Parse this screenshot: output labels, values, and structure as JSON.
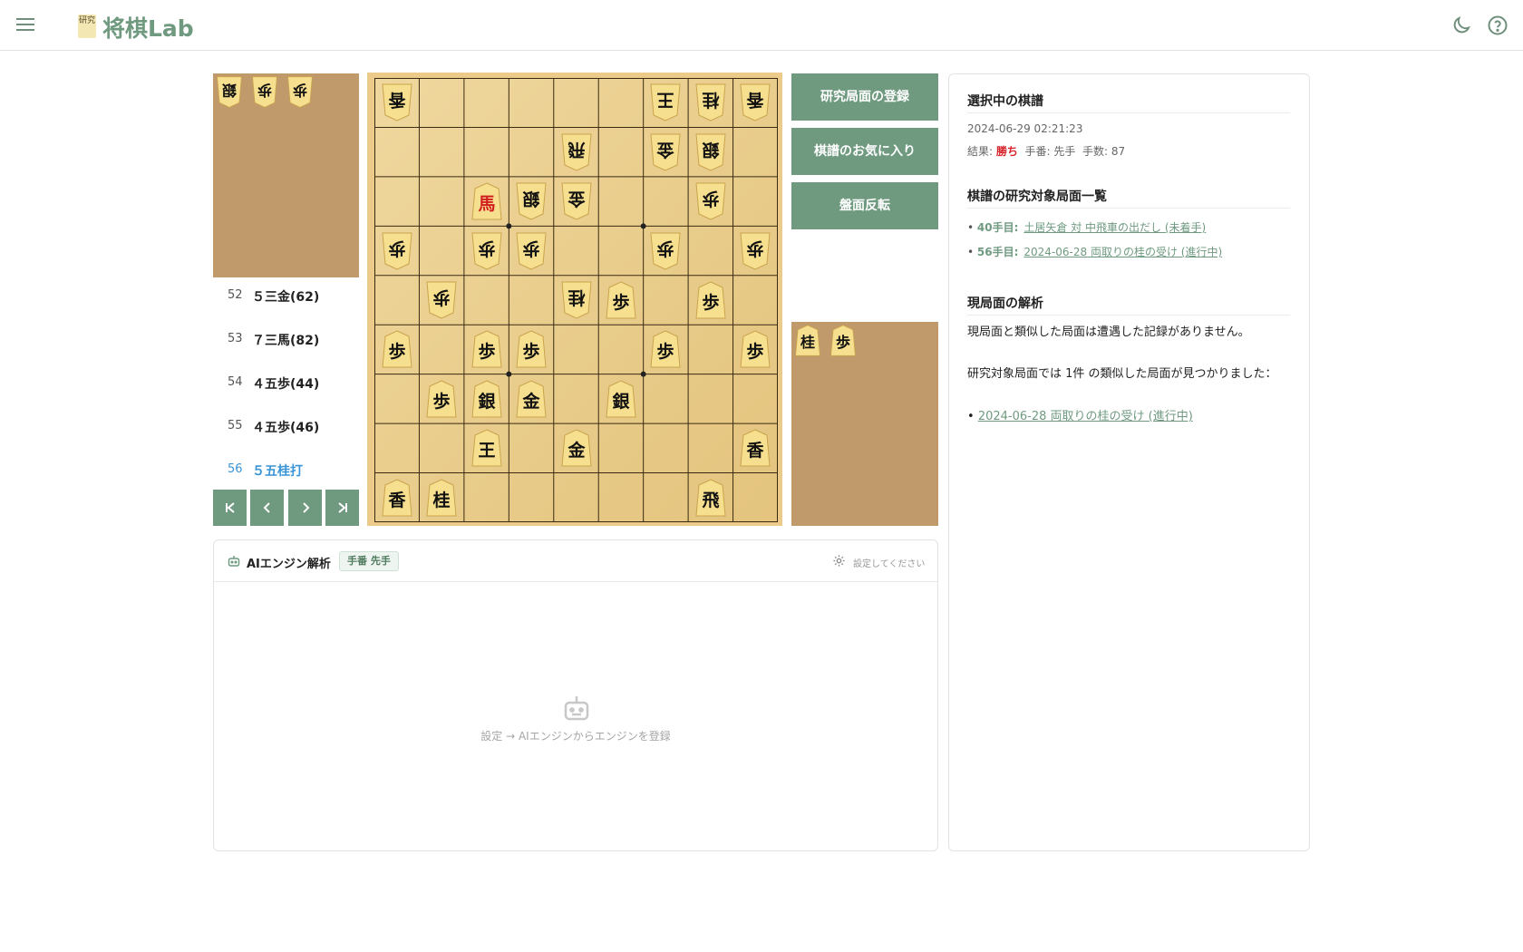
{
  "app": {
    "logo_badge": "研究",
    "title": "将棋Lab"
  },
  "header": {
    "icons": [
      "menu-icon",
      "moon-icon",
      "help-circle-icon"
    ]
  },
  "gote_hand": [
    {
      "kanji": "銀",
      "count": 1
    },
    {
      "kanji": "歩",
      "count": 1
    },
    {
      "kanji": "歩",
      "count": 1
    }
  ],
  "sente_hand": [
    {
      "kanji": "桂",
      "count": 1
    },
    {
      "kanji": "歩",
      "count": 1
    }
  ],
  "kifu": {
    "moves": [
      {
        "num": "52",
        "move": "５三金(62)",
        "current": false
      },
      {
        "num": "53",
        "move": "７三馬(82)",
        "current": false
      },
      {
        "num": "54",
        "move": "４五歩(44)",
        "current": false
      },
      {
        "num": "55",
        "move": "４五歩(46)",
        "current": false
      },
      {
        "num": "56",
        "move": "５五桂打",
        "current": true
      }
    ],
    "nav": {
      "first": "⏮",
      "prev": "‹",
      "next": "›",
      "last": "⏭"
    }
  },
  "board": {
    "pieces": [
      {
        "col": 0,
        "row": 0,
        "kanji": "香",
        "owner": "gote"
      },
      {
        "col": 6,
        "row": 0,
        "kanji": "王",
        "owner": "gote"
      },
      {
        "col": 7,
        "row": 0,
        "kanji": "桂",
        "owner": "gote"
      },
      {
        "col": 8,
        "row": 0,
        "kanji": "香",
        "owner": "gote"
      },
      {
        "col": 4,
        "row": 1,
        "kanji": "飛",
        "owner": "gote"
      },
      {
        "col": 6,
        "row": 1,
        "kanji": "金",
        "owner": "gote"
      },
      {
        "col": 7,
        "row": 1,
        "kanji": "銀",
        "owner": "gote"
      },
      {
        "col": 2,
        "row": 2,
        "kanji": "馬",
        "owner": "sente",
        "promoted": true
      },
      {
        "col": 3,
        "row": 2,
        "kanji": "銀",
        "owner": "gote"
      },
      {
        "col": 4,
        "row": 2,
        "kanji": "金",
        "owner": "gote"
      },
      {
        "col": 7,
        "row": 2,
        "kanji": "歩",
        "owner": "gote"
      },
      {
        "col": 0,
        "row": 3,
        "kanji": "歩",
        "owner": "gote"
      },
      {
        "col": 2,
        "row": 3,
        "kanji": "歩",
        "owner": "gote"
      },
      {
        "col": 3,
        "row": 3,
        "kanji": "歩",
        "owner": "gote"
      },
      {
        "col": 6,
        "row": 3,
        "kanji": "歩",
        "owner": "gote"
      },
      {
        "col": 8,
        "row": 3,
        "kanji": "歩",
        "owner": "gote"
      },
      {
        "col": 1,
        "row": 4,
        "kanji": "歩",
        "owner": "gote"
      },
      {
        "col": 4,
        "row": 4,
        "kanji": "桂",
        "owner": "gote"
      },
      {
        "col": 5,
        "row": 4,
        "kanji": "歩",
        "owner": "sente"
      },
      {
        "col": 7,
        "row": 4,
        "kanji": "歩",
        "owner": "sente"
      },
      {
        "col": 0,
        "row": 5,
        "kanji": "歩",
        "owner": "sente"
      },
      {
        "col": 2,
        "row": 5,
        "kanji": "歩",
        "owner": "sente"
      },
      {
        "col": 3,
        "row": 5,
        "kanji": "歩",
        "owner": "sente"
      },
      {
        "col": 6,
        "row": 5,
        "kanji": "歩",
        "owner": "sente"
      },
      {
        "col": 8,
        "row": 5,
        "kanji": "歩",
        "owner": "sente"
      },
      {
        "col": 1,
        "row": 6,
        "kanji": "歩",
        "owner": "sente"
      },
      {
        "col": 2,
        "row": 6,
        "kanji": "銀",
        "owner": "sente"
      },
      {
        "col": 3,
        "row": 6,
        "kanji": "金",
        "owner": "sente"
      },
      {
        "col": 5,
        "row": 6,
        "kanji": "銀",
        "owner": "sente"
      },
      {
        "col": 2,
        "row": 7,
        "kanji": "王",
        "owner": "sente"
      },
      {
        "col": 4,
        "row": 7,
        "kanji": "金",
        "owner": "sente"
      },
      {
        "col": 8,
        "row": 7,
        "kanji": "香",
        "owner": "sente"
      },
      {
        "col": 0,
        "row": 8,
        "kanji": "香",
        "owner": "sente"
      },
      {
        "col": 1,
        "row": 8,
        "kanji": "桂",
        "owner": "sente"
      },
      {
        "col": 7,
        "row": 8,
        "kanji": "飛",
        "owner": "sente"
      }
    ]
  },
  "actions": {
    "register": "研究局面の登録",
    "favorite": "棋譜のお気に入り",
    "flip": "盤面反転"
  },
  "ai": {
    "title": "AIエンジン解析",
    "badge": "手番 先手",
    "settings": "設定してください",
    "empty_message": "設定 → AIエンジンからエンジンを登録"
  },
  "right": {
    "selected_title": "選択中の棋譜",
    "datetime": "2024-06-29 02:21:23",
    "result_label": "結果:",
    "result_value": "勝ち",
    "turn_text": "手番: 先手",
    "moves_text": "手数: 87",
    "research_title": "棋譜の研究対象局面一覧",
    "research_items": [
      {
        "label": "40手目:",
        "link": "土居矢倉 対 中飛車の出だし (未着手)"
      },
      {
        "label": "56手目:",
        "link": "2024-06-28 両取りの桂の受け (進行中)"
      }
    ],
    "analysis_title": "現局面の解析",
    "analysis_text1": "現局面と類似した局面は遭遇した記録がありません。",
    "analysis_text2": "研究対象局面では 1件 の類似した局面が見つかりました：",
    "analysis_link": "2024-06-28 両取りの桂の受け (進行中)"
  }
}
